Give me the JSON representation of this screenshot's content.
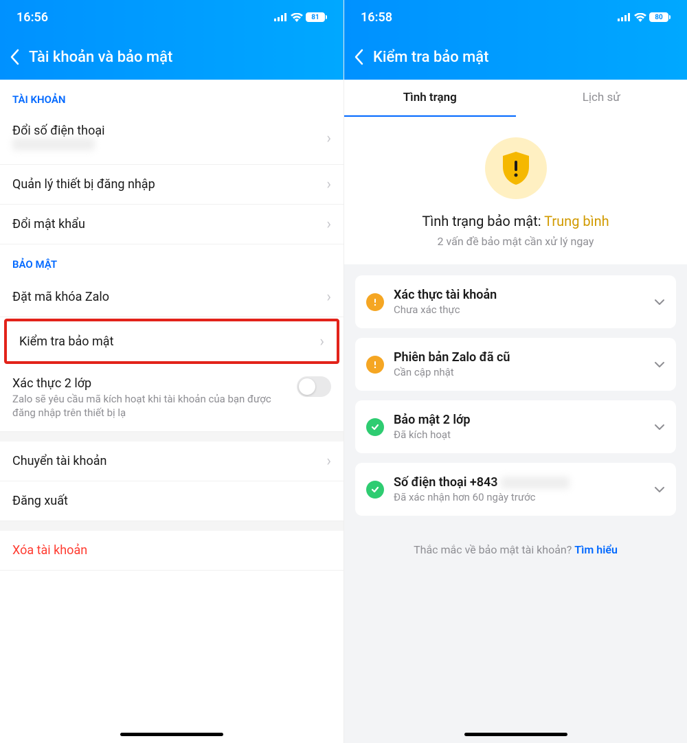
{
  "left": {
    "status": {
      "time": "16:56",
      "battery": "81"
    },
    "nav_title": "Tài khoản và bảo mật",
    "sections": {
      "account": {
        "header": "TÀI KHOẢN",
        "rows": {
          "change_phone": "Đổi số điện thoại",
          "manage_devices": "Quản lý thiết bị đăng nhập",
          "change_password": "Đổi mật khẩu"
        }
      },
      "security": {
        "header": "BẢO MẬT",
        "rows": {
          "lock_zalo": "Đặt mã khóa Zalo",
          "check_security": "Kiểm tra bảo mật",
          "two_factor": {
            "title": "Xác thực 2 lớp",
            "desc": "Zalo sẽ yêu cầu mã kích hoạt khi tài khoản của bạn được đăng nhập trên thiết bị lạ"
          }
        }
      },
      "other": {
        "switch_account": "Chuyển tài khoản",
        "sign_out": "Đăng xuất",
        "delete_account": "Xóa tài khoản"
      }
    }
  },
  "right": {
    "status": {
      "time": "16:58",
      "battery": "80"
    },
    "nav_title": "Kiểm tra bảo mật",
    "tabs": {
      "status": "Tình trạng",
      "history": "Lịch sử"
    },
    "security_status": {
      "label": "Tình trạng bảo mật:",
      "value": "Trung bình",
      "sub": "2 vấn đề bảo mật cần xử lý ngay"
    },
    "cards": {
      "verify_account": {
        "title": "Xác thực tài khoản",
        "sub": "Chưa xác thực",
        "status": "warning"
      },
      "outdated_zalo": {
        "title": "Phiên bản Zalo đã cũ",
        "sub": "Cần cập nhật",
        "status": "warning"
      },
      "two_step": {
        "title": "Bảo mật 2 lớp",
        "sub": "Đã kích hoạt",
        "status": "success"
      },
      "phone": {
        "title": "Số điện thoại +843",
        "sub": "Đã xác nhận hơn 60 ngày trước",
        "status": "success"
      }
    },
    "footer": {
      "text": "Thắc mắc về bảo mật tài khoản? ",
      "link": "Tìm hiểu"
    }
  }
}
